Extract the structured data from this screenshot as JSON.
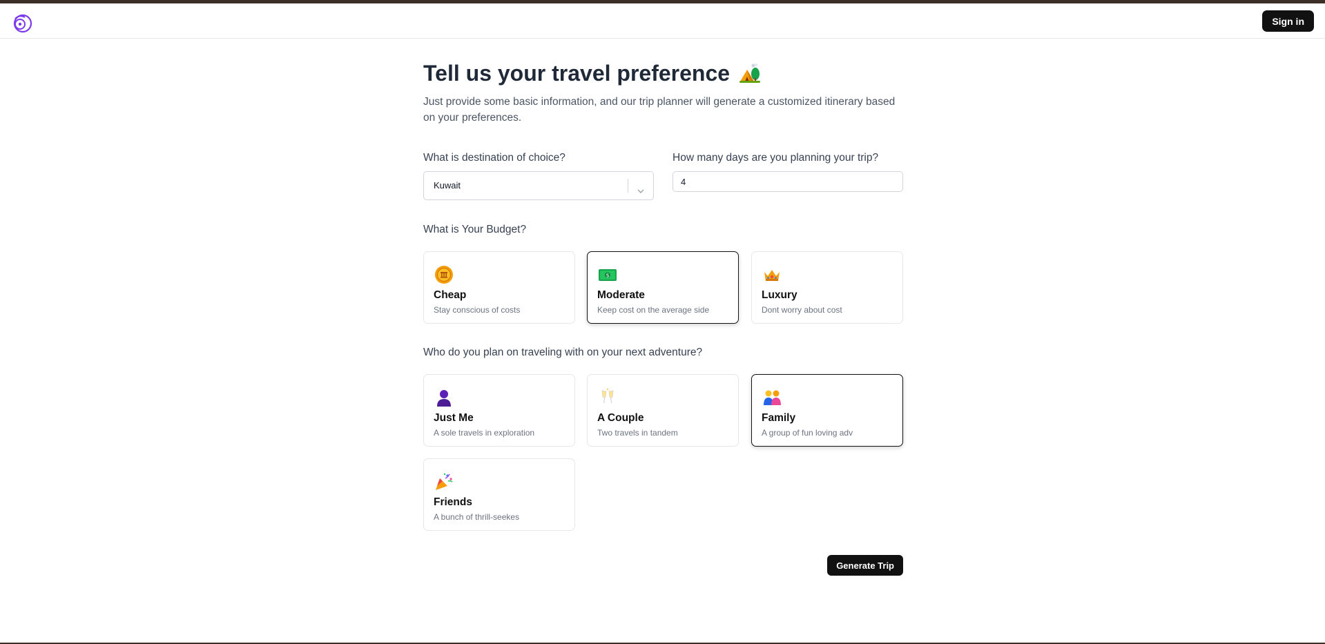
{
  "header": {
    "logo_icon": "swirl-logo-icon",
    "signin_label": "Sign in"
  },
  "hero": {
    "title": "Tell us your travel preference",
    "title_icon": "camping-tent-icon",
    "subtitle": "Just provide some basic information, and our trip planner will generate a customized itinerary based on your preferences."
  },
  "destination": {
    "label": "What is destination of choice?",
    "value": "Kuwait"
  },
  "days": {
    "label": "How many days are you planning your trip?",
    "value": "4"
  },
  "budget": {
    "label": "What is Your Budget?",
    "options": [
      {
        "title": "Cheap",
        "desc": "Stay conscious of costs",
        "icon": "coin-icon",
        "selected": false
      },
      {
        "title": "Moderate",
        "desc": "Keep cost on the average side",
        "icon": "money-banknote-icon",
        "selected": true
      },
      {
        "title": "Luxury",
        "desc": "Dont worry about cost",
        "icon": "crown-icon",
        "selected": false
      }
    ]
  },
  "travelers": {
    "label": "Who do you plan on traveling with on your next adventure?",
    "options": [
      {
        "title": "Just Me",
        "desc": "A sole travels in exploration",
        "icon": "person-silhouette-icon",
        "selected": false
      },
      {
        "title": "A Couple",
        "desc": "Two travels in tandem",
        "icon": "clinking-glasses-icon",
        "selected": false
      },
      {
        "title": "Family",
        "desc": "A group of fun loving adv",
        "icon": "family-icon",
        "selected": true
      },
      {
        "title": "Friends",
        "desc": "A bunch of thrill-seekes",
        "icon": "party-popper-icon",
        "selected": false
      }
    ]
  },
  "actions": {
    "generate_label": "Generate Trip"
  },
  "colors": {
    "accent_logo": "#7c3aed",
    "button_bg": "#111111",
    "top_bar": "#3b2f28"
  }
}
